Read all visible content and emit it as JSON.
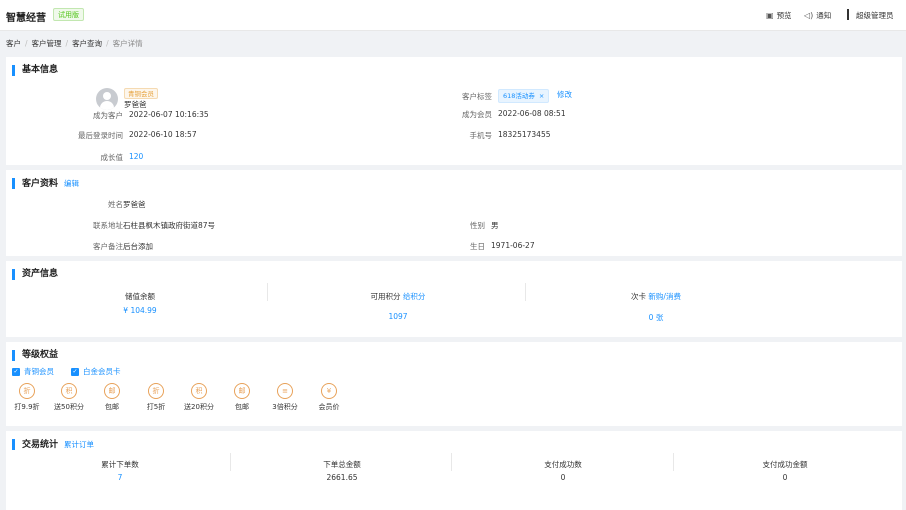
{
  "header": {
    "brand": "智慧经营",
    "trial_badge": "试用版",
    "preview": "预览",
    "notify": "通知",
    "user": "超级管理员"
  },
  "breadcrumb": [
    "客户",
    "客户管理",
    "客户查询",
    "客户详情"
  ],
  "basic": {
    "title": "基本信息",
    "level_tag": "青铜会员",
    "name": "罗爸爸",
    "became_customer_label": "成为客户",
    "became_customer": "2022-06-07 10:16:35",
    "last_login_label": "最后登录时间",
    "last_login": "2022-06-10 18:57",
    "growth_label": "成长值",
    "growth": "120",
    "tag_label": "客户标签",
    "tag": "618活动券",
    "tag_close": "×",
    "tag_edit": "修改",
    "became_member_label": "成为会员",
    "became_member": "2022-06-08 08:51",
    "phone_label": "手机号",
    "phone": "18325173455"
  },
  "profile": {
    "title": "客户资料",
    "edit": "编辑",
    "name_label": "姓名",
    "name": "罗爸爸",
    "address_label": "联系地址",
    "address": "石柱县枫木镇政府街道87号",
    "remark_label": "客户备注",
    "remark": "后台添加",
    "gender_label": "性别",
    "gender": "男",
    "birthday_label": "生日",
    "birthday": "1971-06-27"
  },
  "assets": {
    "title": "资产信息",
    "balance_label": "储值余额",
    "balance": "¥ 104.99",
    "points_label": "可用积分",
    "points_link": "给积分",
    "points": "1097",
    "card_label": "次卡",
    "card_link": "新购/消费",
    "card": "0 张"
  },
  "rights": {
    "title": "等级权益",
    "levels": [
      "青铜会员",
      "白金会员卡"
    ],
    "benefits": [
      {
        "label": "打9.9折",
        "icon": "discount-icon",
        "glyph": "折"
      },
      {
        "label": "送50积分",
        "icon": "points-icon",
        "glyph": "积"
      },
      {
        "label": "包邮",
        "icon": "free-shipping-icon",
        "glyph": "邮"
      },
      {
        "label": "打5折",
        "icon": "discount-icon",
        "glyph": "折"
      },
      {
        "label": "送20积分",
        "icon": "points-icon",
        "glyph": "积"
      },
      {
        "label": "包邮",
        "icon": "free-shipping-icon",
        "glyph": "邮"
      },
      {
        "label": "3倍积分",
        "icon": "coins-icon",
        "glyph": "≡"
      },
      {
        "label": "会员价",
        "icon": "member-price-icon",
        "glyph": "¥"
      }
    ]
  },
  "trade": {
    "title": "交易统计",
    "link": "累计订单",
    "stats": [
      {
        "label": "累计下单数",
        "value": "7",
        "highlight": true
      },
      {
        "label": "下单总金额",
        "value": "2661.65",
        "highlight": false
      },
      {
        "label": "支付成功数",
        "value": "0",
        "highlight": false
      },
      {
        "label": "支付成功金额",
        "value": "0",
        "highlight": false
      }
    ]
  },
  "colors": {
    "accent": "#1890ff",
    "bronze": "#e6a23c",
    "benefit": "#e8a25a",
    "trial": "#52c41a"
  }
}
